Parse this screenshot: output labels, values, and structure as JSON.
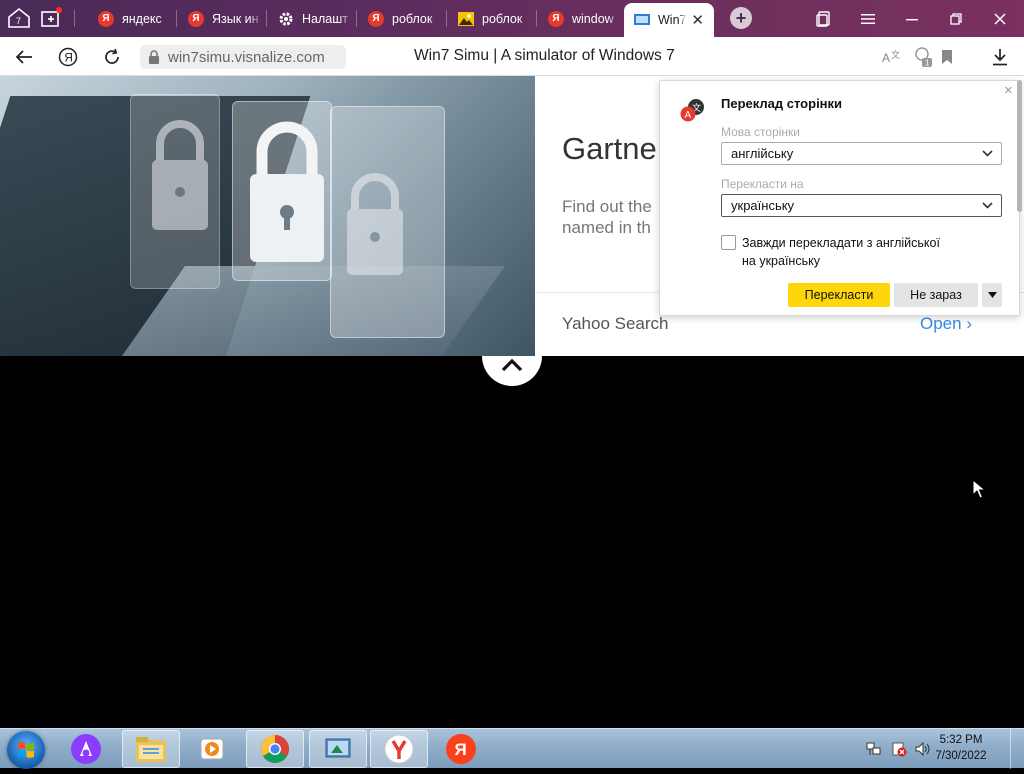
{
  "browser": {
    "tabs": [
      {
        "label": "яндекс",
        "favicon": "yandex-icon"
      },
      {
        "label": "Язык ин",
        "favicon": "yandex-icon"
      },
      {
        "label": "Налашт",
        "favicon": "gear-icon"
      },
      {
        "label": "роблок",
        "favicon": "yandex-icon"
      },
      {
        "label": "роблок",
        "favicon": "image-icon"
      },
      {
        "label": "window",
        "favicon": "yandex-icon"
      },
      {
        "label": "Win7",
        "favicon": "win7-icon",
        "active": true
      }
    ],
    "url": "win7simu.visnalize.com",
    "page_title": "Win7 Simu | A simulator of Windows 7"
  },
  "page": {
    "headline": "Gartne",
    "subtitle_line1": "Find out the",
    "subtitle_line2": "named in th",
    "yahoo_label": "Yahoo Search",
    "open_label": "Open"
  },
  "translate_popup": {
    "title": "Переклад сторінки",
    "page_language_label": "Мова сторінки",
    "page_language_value": "англійську",
    "translate_to_label": "Перекласти на",
    "translate_to_value": "українську",
    "always_translate_line1": "Завжди перекладати з англійської",
    "always_translate_line2": "на українську",
    "translate_button": "Перекласти",
    "not_now_button": "Не зараз"
  },
  "taskbar": {
    "time": "5:32 PM",
    "date": "7/30/2022"
  },
  "colors": {
    "tabbar": "#5b2c5e",
    "translate_button": "#ffd60a",
    "link": "#3a88e0",
    "yandex_red": "#e63a2e"
  }
}
